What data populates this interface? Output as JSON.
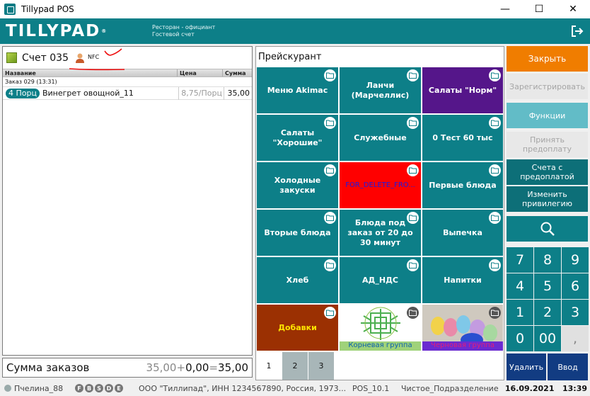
{
  "window": {
    "title": "Tillypad POS",
    "minimize": "—",
    "maximize": "☐",
    "close": "✕"
  },
  "header": {
    "logo": "TILLYPAD",
    "role": "Ресторан - официант",
    "mode": "Гостевой счет"
  },
  "order": {
    "title": "Счет 035",
    "nfc_label": "NFC",
    "columns": {
      "name": "Название",
      "price": "Цена",
      "sum": "Сумма"
    },
    "info": "Заказ 029 (13:31)",
    "rows": [
      {
        "qty": "4 Порц",
        "name": "Винегрет овощной_11",
        "price": "8,75/Порц",
        "sum": "35,00"
      }
    ]
  },
  "total": {
    "label": "Сумма заказов",
    "orders": "35,00",
    "plus": "+",
    "extra": "0,00",
    "eq": "=",
    "result": "35,00"
  },
  "pricelist": {
    "title": "Прейскурант",
    "tiles": [
      {
        "label": "Меню Akimac",
        "style": "teal"
      },
      {
        "label": "Ланчи (Марчеллис)",
        "style": "teal"
      },
      {
        "label": "Салаты \"Норм\"",
        "style": "purple"
      },
      {
        "label": "Салаты \"Хорошие\"",
        "style": "teal"
      },
      {
        "label": "Служебные",
        "style": "teal"
      },
      {
        "label": "0 Тест 60 тыс",
        "style": "teal"
      },
      {
        "label": "Холодные закуски",
        "style": "teal"
      },
      {
        "label": "FOR_DELETE_FRO...",
        "style": "red"
      },
      {
        "label": "Первые блюда",
        "style": "teal"
      },
      {
        "label": "Вторые блюда",
        "style": "teal"
      },
      {
        "label": "Блюда под заказ от 20 до 30 минут",
        "style": "teal"
      },
      {
        "label": "Выпечка",
        "style": "teal"
      },
      {
        "label": "Хлеб",
        "style": "teal"
      },
      {
        "label": "АД_НДС",
        "style": "teal"
      },
      {
        "label": "Напитки",
        "style": "teal"
      },
      {
        "label": "Добавки",
        "style": "brown"
      },
      {
        "label": "Корневая группа",
        "style": "pic-root"
      },
      {
        "label": "Черновая группа",
        "style": "pic-eggs"
      }
    ],
    "pages": [
      "1",
      "2",
      "3"
    ],
    "active_page": "1"
  },
  "actions": {
    "close": "Закрыть",
    "register": "Зарегистрировать",
    "functions": "Функции",
    "prepay": "Принять предоплату",
    "prepaid_bills": "Счета с предоплатой",
    "privilege": "Изменить привилегию",
    "delete": "Удалить",
    "enter": "Ввод"
  },
  "numpad": [
    "7",
    "8",
    "9",
    "4",
    "5",
    "6",
    "1",
    "2",
    "3",
    "0",
    "00",
    ","
  ],
  "status": {
    "user": "Пчелина_88",
    "badges": [
      "F",
      "B",
      "S",
      "D",
      "E"
    ],
    "org": "ООО \"Тиллипад\", ИНН 1234567890, Россия, 1973...",
    "pos": "POS_10.1",
    "dept": "Чистое_Подразделение",
    "date": "16.09.2021",
    "time": "13:39"
  },
  "colors": {
    "teal": "#0d7f88",
    "orange": "#f07d00",
    "purple": "#55168a",
    "red": "#ff0000",
    "brown": "#9b3002",
    "navy": "#123c82"
  }
}
